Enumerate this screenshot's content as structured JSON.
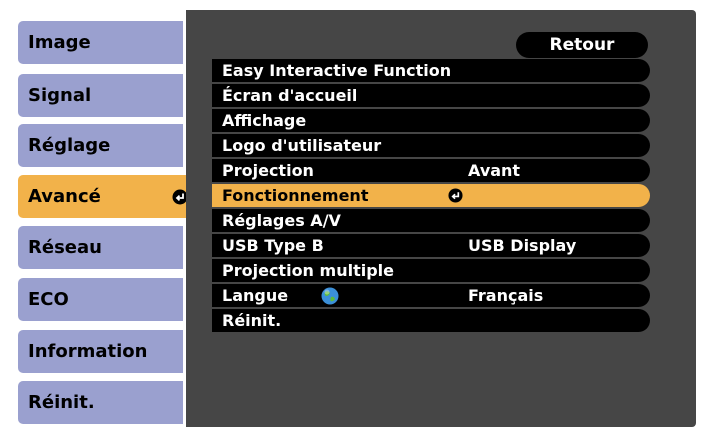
{
  "sidebar": {
    "items": [
      {
        "label": "Image"
      },
      {
        "label": "Signal"
      },
      {
        "label": "Réglage"
      },
      {
        "label": "Avancé"
      },
      {
        "label": "Réseau"
      },
      {
        "label": "ECO"
      },
      {
        "label": "Information"
      },
      {
        "label": "Réinit."
      }
    ],
    "selected": "Avancé"
  },
  "menu": {
    "back_label": "Retour",
    "items": [
      {
        "label": "Easy Interactive Function",
        "value": ""
      },
      {
        "label": "Écran d'accueil",
        "value": ""
      },
      {
        "label": "Affichage",
        "value": ""
      },
      {
        "label": "Logo d'utilisateur",
        "value": ""
      },
      {
        "label": "Projection",
        "value": "Avant"
      },
      {
        "label": "Fonctionnement",
        "value": ""
      },
      {
        "label": "Réglages A/V",
        "value": ""
      },
      {
        "label": "USB Type B",
        "value": "USB Display"
      },
      {
        "label": "Projection multiple",
        "value": ""
      },
      {
        "label": "Langue",
        "value": "Français"
      },
      {
        "label": "Réinit.",
        "value": ""
      }
    ],
    "selected": "Fonctionnement"
  },
  "icons": {
    "enter": "enter-icon",
    "globe": "globe-icon"
  },
  "colors": {
    "sidebar": "#9aa0cf",
    "highlight": "#f2b24a",
    "panel": "#464646",
    "row": "#000000"
  }
}
